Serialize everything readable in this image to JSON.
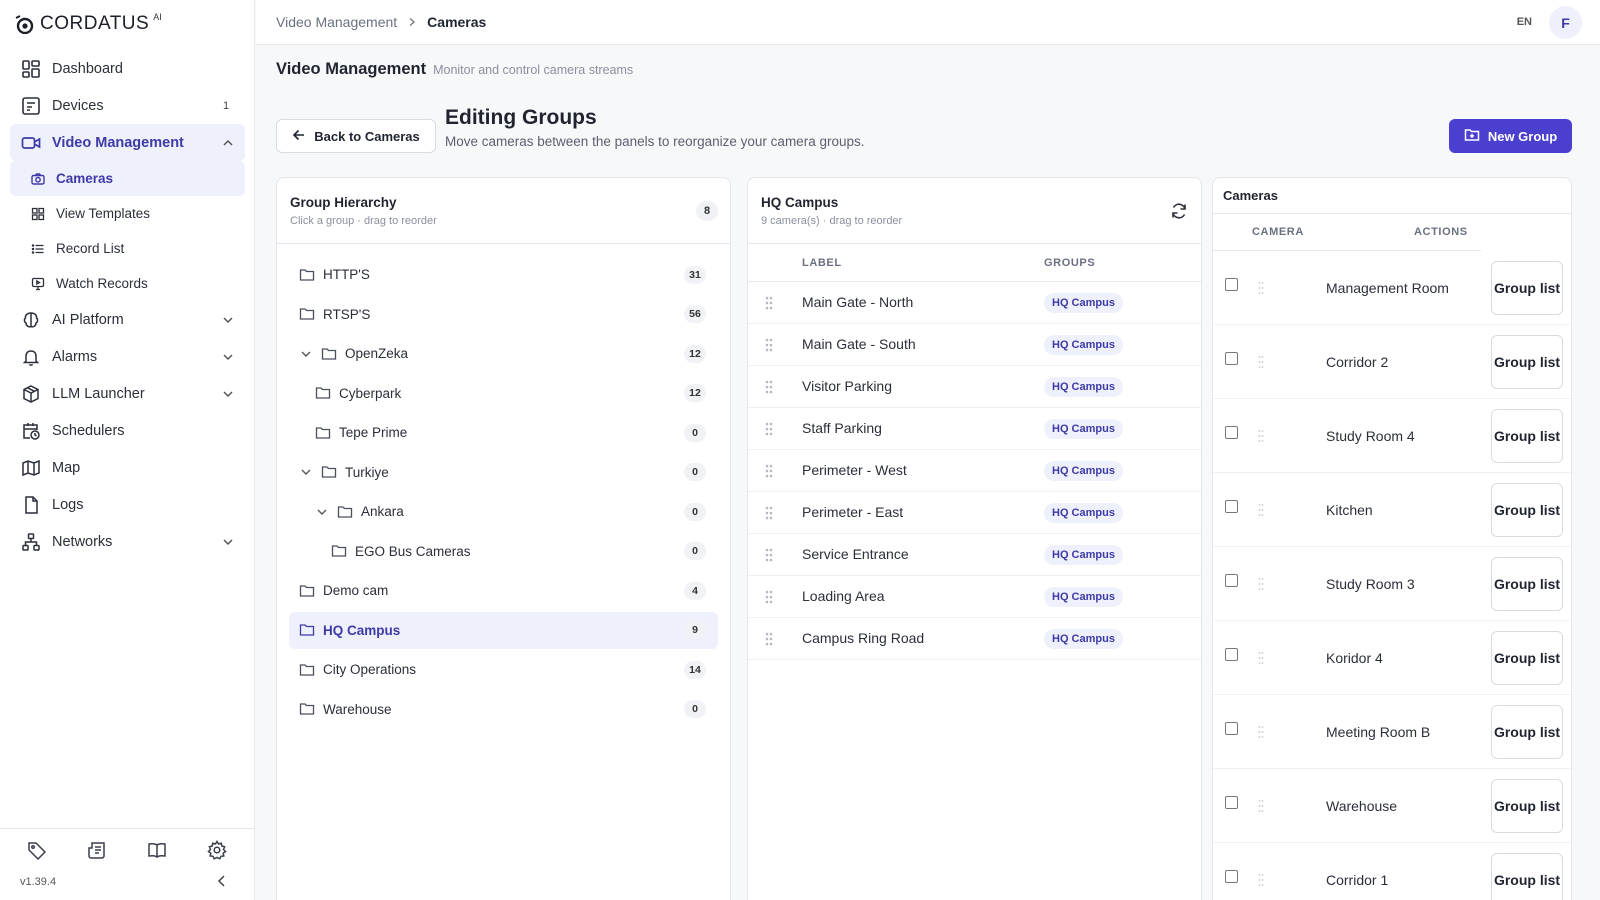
{
  "brand": {
    "name": "CORDATUS",
    "sup": "AI"
  },
  "sidebar": {
    "items": [
      {
        "label": "Dashboard",
        "badge": "",
        "icon": "dashboard-icon"
      },
      {
        "label": "Devices",
        "badge": "1",
        "icon": "devices-icon"
      },
      {
        "label": "Video Management",
        "badge": "",
        "icon": "video-icon",
        "expanded": true,
        "children": [
          {
            "label": "Cameras",
            "icon": "camera-icon",
            "active": true
          },
          {
            "label": "View Templates",
            "icon": "grid-icon"
          },
          {
            "label": "Record List",
            "icon": "list-icon"
          },
          {
            "label": "Watch Records",
            "icon": "monitor-play-icon"
          }
        ]
      },
      {
        "label": "AI Platform",
        "badge": "",
        "icon": "brain-icon",
        "collapsible": true
      },
      {
        "label": "Alarms",
        "badge": "",
        "icon": "bell-icon",
        "collapsible": true
      },
      {
        "label": "LLM Launcher",
        "badge": "",
        "icon": "package-icon",
        "collapsible": true
      },
      {
        "label": "Schedulers",
        "badge": "",
        "icon": "calendar-clock-icon"
      },
      {
        "label": "Map",
        "badge": "",
        "icon": "map-icon"
      },
      {
        "label": "Logs",
        "badge": "",
        "icon": "file-icon"
      },
      {
        "label": "Networks",
        "badge": "",
        "icon": "network-icon",
        "collapsible": true
      }
    ],
    "footer_icons": [
      "tag-icon",
      "newspaper-icon",
      "book-icon",
      "gear-icon"
    ],
    "version": "v1.39.4"
  },
  "topbar": {
    "breadcrumb": [
      "Video Management",
      "Cameras"
    ],
    "lang": "EN",
    "avatar": "F"
  },
  "page": {
    "title": "Video Management",
    "subtitle": "Monitor and control camera streams",
    "back_label": "Back to Cameras",
    "edit_title": "Editing Groups",
    "edit_subtitle": "Move cameras between the panels to reorganize your camera groups.",
    "new_group_label": "New Group"
  },
  "hierarchy": {
    "title": "Group Hierarchy",
    "subtitle": "Click a group · drag to reorder",
    "count": "8",
    "nodes": [
      {
        "label": "HTTP'S",
        "count": "31",
        "depth": 0,
        "chevron": false
      },
      {
        "label": "RTSP'S",
        "count": "56",
        "depth": 0,
        "chevron": false
      },
      {
        "label": "OpenZeka",
        "count": "12",
        "depth": 0,
        "chevron": true
      },
      {
        "label": "Cyberpark",
        "count": "12",
        "depth": 1,
        "chevron": false
      },
      {
        "label": "Tepe Prime",
        "count": "0",
        "depth": 1,
        "chevron": false
      },
      {
        "label": "Turkiye",
        "count": "0",
        "depth": 0,
        "chevron": true
      },
      {
        "label": "Ankara",
        "count": "0",
        "depth": 1,
        "chevron": true
      },
      {
        "label": "EGO Bus Cameras",
        "count": "0",
        "depth": 2,
        "chevron": false
      },
      {
        "label": "Demo cam",
        "count": "4",
        "depth": 0,
        "chevron": false
      },
      {
        "label": "HQ Campus",
        "count": "9",
        "depth": 0,
        "chevron": false,
        "selected": true
      },
      {
        "label": "City Operations",
        "count": "14",
        "depth": 0,
        "chevron": false
      },
      {
        "label": "Warehouse",
        "count": "0",
        "depth": 0,
        "chevron": false
      }
    ]
  },
  "group_panel": {
    "title": "HQ Campus",
    "subtitle": "9 camera(s) · drag to reorder",
    "col_label": "LABEL",
    "col_groups": "GROUPS",
    "rows": [
      {
        "label": "Main Gate - North",
        "group": "HQ Campus"
      },
      {
        "label": "Main Gate - South",
        "group": "HQ Campus"
      },
      {
        "label": "Visitor Parking",
        "group": "HQ Campus"
      },
      {
        "label": "Staff Parking",
        "group": "HQ Campus"
      },
      {
        "label": "Perimeter - West",
        "group": "HQ Campus"
      },
      {
        "label": "Perimeter - East",
        "group": "HQ Campus"
      },
      {
        "label": "Service Entrance",
        "group": "HQ Campus"
      },
      {
        "label": "Loading Area",
        "group": "HQ Campus"
      },
      {
        "label": "Campus Ring Road",
        "group": "HQ Campus"
      }
    ]
  },
  "cameras_panel": {
    "title": "Cameras",
    "col_camera": "CAMERA",
    "col_actions": "ACTIONS",
    "action_label": "Group list",
    "rows": [
      {
        "label": "Management Room"
      },
      {
        "label": "Corridor 2"
      },
      {
        "label": "Study Room 4"
      },
      {
        "label": "Kitchen"
      },
      {
        "label": "Study Room 3"
      },
      {
        "label": "Koridor 4"
      },
      {
        "label": "Meeting Room B"
      },
      {
        "label": "Warehouse"
      },
      {
        "label": "Corridor 1"
      }
    ]
  }
}
